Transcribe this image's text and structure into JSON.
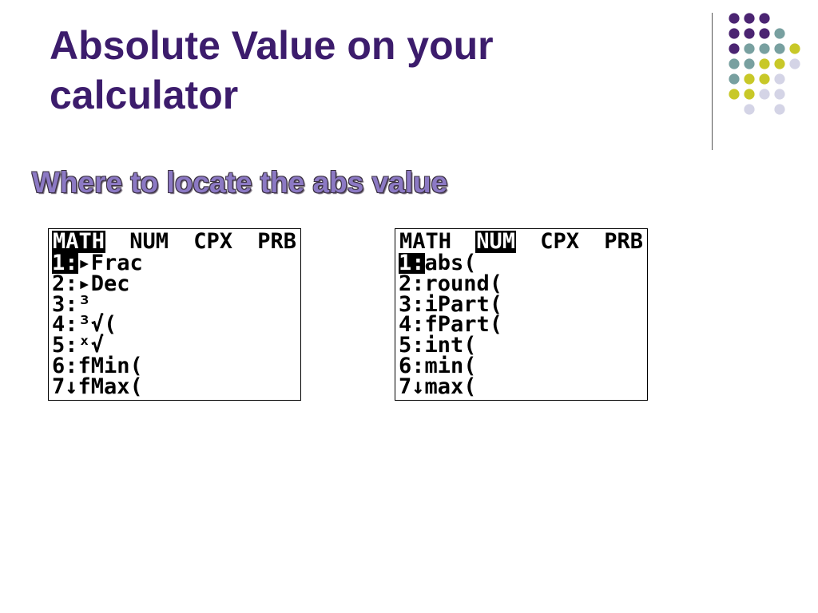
{
  "slide": {
    "title_line1": "Absolute Value on your",
    "title_line2": "calculator",
    "subtitle": "Where to locate the abs value"
  },
  "colors": {
    "title": "#3c1c6c",
    "subtitle_fill": "#8c79c4",
    "dot_purple": "#4b2472",
    "dot_teal": "#78a0a0",
    "dot_yellow": "#c8c828",
    "dot_lavender": "#d4d4e6"
  },
  "dot_pattern": [
    [
      "purple",
      "purple",
      "purple",
      null,
      null
    ],
    [
      "purple",
      "purple",
      "purple",
      "teal",
      null
    ],
    [
      "purple",
      "teal",
      "teal",
      "teal",
      "yellow"
    ],
    [
      "teal",
      "teal",
      "yellow",
      "yellow",
      "lavender"
    ],
    [
      "teal",
      "yellow",
      "yellow",
      "lavender",
      null
    ],
    [
      "yellow",
      "yellow",
      "lavender",
      "lavender",
      null
    ],
    [
      null,
      "lavender",
      null,
      "lavender",
      null
    ]
  ],
  "screens": {
    "math": {
      "tabs": [
        "MATH",
        "NUM",
        "CPX",
        "PRB"
      ],
      "active_tab": 0,
      "items": [
        {
          "key": "1:",
          "sep": "",
          "label": "▸Frac"
        },
        {
          "key": "2:",
          "sep": "",
          "label": "▸Dec"
        },
        {
          "key": "3:",
          "sep": "",
          "label": "³"
        },
        {
          "key": "4:",
          "sep": "",
          "label": "³√("
        },
        {
          "key": "5:",
          "sep": "",
          "label": "ˣ√"
        },
        {
          "key": "6:",
          "sep": "",
          "label": "fMin("
        },
        {
          "key": "7",
          "sep": "↓",
          "label": "fMax("
        }
      ]
    },
    "num": {
      "tabs": [
        "MATH",
        "NUM",
        "CPX",
        "PRB"
      ],
      "active_tab": 1,
      "items": [
        {
          "key": "1:",
          "sep": "",
          "label": "abs("
        },
        {
          "key": "2:",
          "sep": "",
          "label": "round("
        },
        {
          "key": "3:",
          "sep": "",
          "label": "iPart("
        },
        {
          "key": "4:",
          "sep": "",
          "label": "fPart("
        },
        {
          "key": "5:",
          "sep": "",
          "label": "int("
        },
        {
          "key": "6:",
          "sep": "",
          "label": "min("
        },
        {
          "key": "7",
          "sep": "↓",
          "label": "max("
        }
      ]
    }
  }
}
